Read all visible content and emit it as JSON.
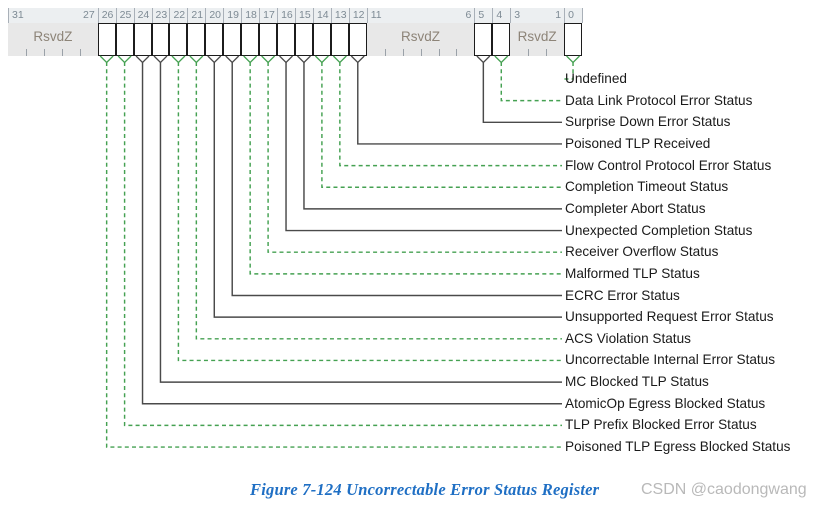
{
  "figure": {
    "caption": "Figure  7-124  Uncorrectable Error Status Register",
    "watermark": "CSDN @caodongwang",
    "caption_color": "#1f6fc4",
    "watermark_color": "#b9b9b9"
  },
  "register": {
    "name": "Uncorrectable Error Status Register",
    "width_bits": 32,
    "reserved_label": "RsvdZ",
    "colors": {
      "reserved_fill": "#e8e8e8",
      "reserved_text": "#8d8478",
      "bit_fill": "#ffffff",
      "bit_border": "#1c1c1c",
      "number_text": "#7d8a94",
      "number_fill": "#eceff1",
      "leader_green": "#45a152",
      "leader_dark": "#4a4a4a"
    },
    "fields": [
      {
        "kind": "reserved",
        "hi": 31,
        "lo": 27,
        "label": "RsvdZ",
        "hi_text": "31",
        "lo_text": "27"
      },
      {
        "kind": "bit",
        "bit": 26,
        "label": "26"
      },
      {
        "kind": "bit",
        "bit": 25,
        "label": "25"
      },
      {
        "kind": "bit",
        "bit": 24,
        "label": "24"
      },
      {
        "kind": "bit",
        "bit": 23,
        "label": "23"
      },
      {
        "kind": "bit",
        "bit": 22,
        "label": "22"
      },
      {
        "kind": "bit",
        "bit": 21,
        "label": "21"
      },
      {
        "kind": "bit",
        "bit": 20,
        "label": "20"
      },
      {
        "kind": "bit",
        "bit": 19,
        "label": "19"
      },
      {
        "kind": "bit",
        "bit": 18,
        "label": "18"
      },
      {
        "kind": "bit",
        "bit": 17,
        "label": "17"
      },
      {
        "kind": "bit",
        "bit": 16,
        "label": "16"
      },
      {
        "kind": "bit",
        "bit": 15,
        "label": "15"
      },
      {
        "kind": "bit",
        "bit": 14,
        "label": "14"
      },
      {
        "kind": "bit",
        "bit": 13,
        "label": "13"
      },
      {
        "kind": "bit",
        "bit": 12,
        "label": "12"
      },
      {
        "kind": "reserved",
        "hi": 11,
        "lo": 6,
        "label": "RsvdZ",
        "hi_text": "11",
        "lo_text": "6"
      },
      {
        "kind": "bit",
        "bit": 5,
        "label": "5"
      },
      {
        "kind": "bit",
        "bit": 4,
        "label": "4"
      },
      {
        "kind": "reserved",
        "hi": 3,
        "lo": 1,
        "label": "RsvdZ",
        "hi_text": "3",
        "lo_text": "1"
      },
      {
        "kind": "bit",
        "bit": 0,
        "label": "0"
      }
    ],
    "callouts": [
      {
        "bit": 0,
        "text": "Undefined",
        "leader": "green"
      },
      {
        "bit": 4,
        "text": "Data Link Protocol Error Status",
        "leader": "green"
      },
      {
        "bit": 5,
        "text": "Surprise Down Error Status",
        "leader": "dark"
      },
      {
        "bit": 12,
        "text": "Poisoned TLP Received",
        "leader": "dark"
      },
      {
        "bit": 13,
        "text": "Flow Control Protocol Error Status",
        "leader": "green"
      },
      {
        "bit": 14,
        "text": "Completion Timeout Status",
        "leader": "green"
      },
      {
        "bit": 15,
        "text": "Completer Abort Status",
        "leader": "dark"
      },
      {
        "bit": 16,
        "text": "Unexpected Completion Status",
        "leader": "dark"
      },
      {
        "bit": 17,
        "text": "Receiver Overflow Status",
        "leader": "green"
      },
      {
        "bit": 18,
        "text": "Malformed TLP Status",
        "leader": "green"
      },
      {
        "bit": 19,
        "text": "ECRC Error Status",
        "leader": "dark"
      },
      {
        "bit": 20,
        "text": "Unsupported Request Error Status",
        "leader": "dark"
      },
      {
        "bit": 21,
        "text": "ACS Violation Status",
        "leader": "green"
      },
      {
        "bit": 22,
        "text": "Uncorrectable Internal Error Status",
        "leader": "green"
      },
      {
        "bit": 23,
        "text": "MC Blocked TLP Status",
        "leader": "dark"
      },
      {
        "bit": 24,
        "text": "AtomicOp Egress Blocked Status",
        "leader": "dark"
      },
      {
        "bit": 25,
        "text": "TLP Prefix Blocked Error Status",
        "leader": "green"
      },
      {
        "bit": 26,
        "text": "Poisoned TLP Egress Blocked Status",
        "leader": "green"
      }
    ]
  }
}
